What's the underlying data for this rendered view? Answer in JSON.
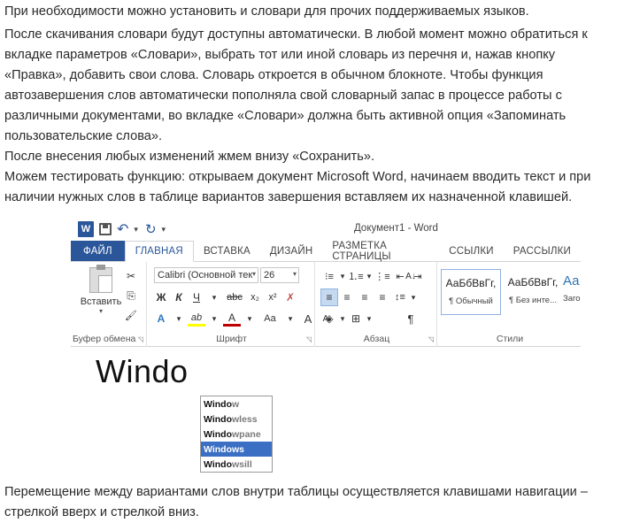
{
  "article": {
    "p1": "При необходимости можно установить и словари для прочих поддерживаемых языков.",
    "p2_lines": [
      "После скачивания словари будут доступны автоматически. В любой момент можно обратиться к",
      "вкладке параметров «Словари», выбрать тот или иной словарь из перечня и, нажав кнопку",
      "«Правка», добавить свои слова. Словарь откроется в обычном блокноте. Чтобы функция",
      "автозавершения слов автоматически пополняла свой словарный запас в процессе работы с",
      "различными документами, во вкладке «Словари» должна быть активной опция «Запоминать",
      "пользовательские слова».",
      "После внесения любых изменений жмем внизу «Сохранить».",
      "Можем тестировать функцию: открываем документ Microsoft Word, начинаем вводить текст и при",
      "наличии нужных слов в таблице вариантов завершения вставляем их назначенной клавишей."
    ],
    "p3_lines": [
      "Перемещение между вариантами слов внутри таблицы осуществляется клавишами навигации –",
      "стрелкой вверх и стрелкой вниз."
    ]
  },
  "word": {
    "window_title": "Документ1 - Word",
    "word_logo": "W",
    "undo_symbol": "↶",
    "redo_symbol": "↻",
    "qa_dropdown": "▾",
    "tabs": [
      "ФАЙЛ",
      "ГЛАВНАЯ",
      "ВСТАВКА",
      "ДИЗАЙН",
      "РАЗМЕТКА СТРАНИЦЫ",
      "ССЫЛКИ",
      "РАССЫЛКИ"
    ],
    "clipboard": {
      "paste_label": "Вставить",
      "group_label": "Буфер обмена",
      "cut": "✂",
      "copy": "⎘",
      "format_painter": "🖌"
    },
    "font": {
      "name": "Calibri (Основной тек",
      "size": "26",
      "grow": "A",
      "shrink": "A",
      "case": "Aa",
      "clear": "✗",
      "bold": "Ж",
      "italic": "К",
      "underline": "Ч",
      "strike": "abc",
      "sub": "x₂",
      "sup": "x²",
      "effects": "A",
      "highlight": "ab",
      "color": "A",
      "aa": "Aa",
      "grow2": "A",
      "shrink2": "A",
      "group_label": "Шрифт"
    },
    "paragraph": {
      "group_label": "Абзац",
      "pilcrow": "¶",
      "sort": "A↓"
    },
    "styles": {
      "group_label": "Стили",
      "items": [
        {
          "sample": "АаБбВвГг,",
          "name": "¶ Обычный"
        },
        {
          "sample": "АаБбВвГг,",
          "name": "¶ Без инте..."
        },
        {
          "sample": "Аа",
          "name": "Заго"
        }
      ]
    },
    "document": {
      "typed_text": "Windo",
      "suggestions": [
        {
          "typed": "Windo",
          "rest": "w"
        },
        {
          "typed": "Windo",
          "rest": "wless"
        },
        {
          "typed": "Windo",
          "rest": "wpane"
        },
        {
          "typed": "Windo",
          "rest": "ws",
          "selected": true
        },
        {
          "typed": "Windo",
          "rest": "wsill"
        }
      ]
    }
  },
  "colors": {
    "word_blue": "#2b579a",
    "selection_blue": "#3b6fc4",
    "font_color_red": "#c00000",
    "highlight_yellow": "#ffff00"
  }
}
